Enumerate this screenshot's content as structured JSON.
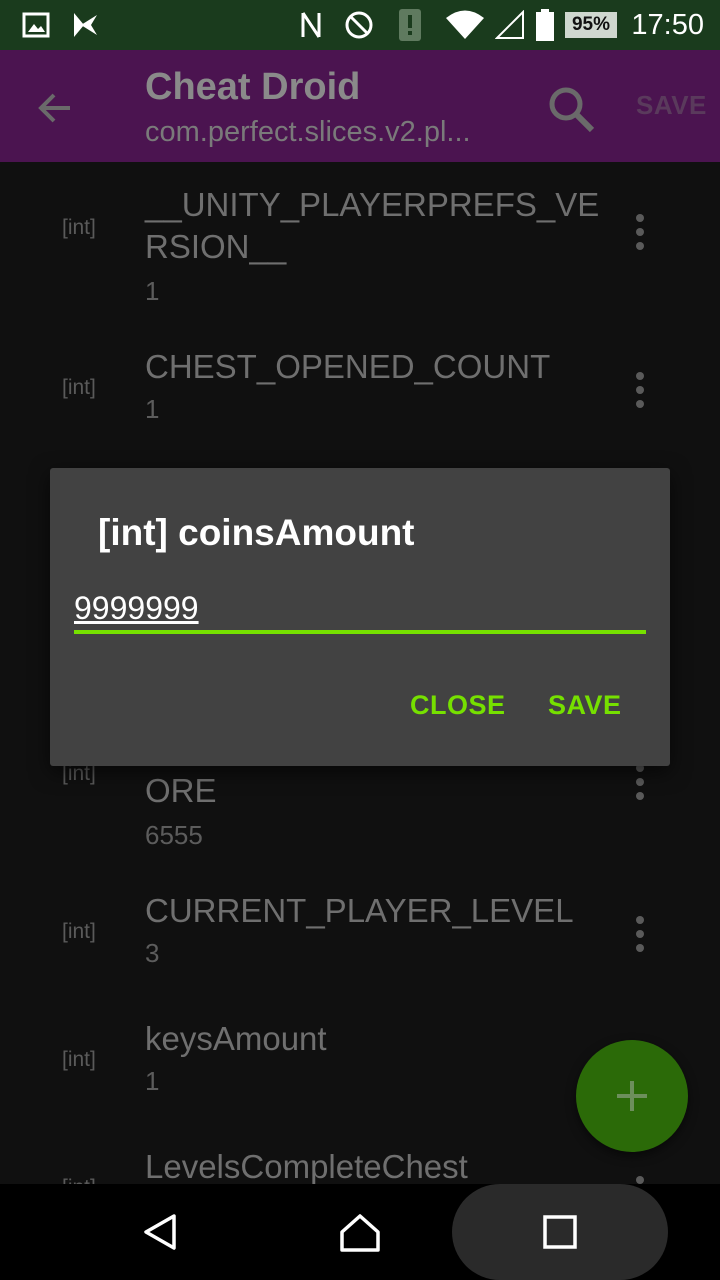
{
  "status_bar": {
    "time": "17:50",
    "battery_percent": "95%",
    "icons": [
      "image-notification-icon",
      "app-notification-icon",
      "nfc-icon",
      "do-not-disturb-icon",
      "alert-icon",
      "wifi-icon",
      "signal-icon",
      "battery-icon"
    ]
  },
  "toolbar": {
    "title": "Cheat Droid",
    "subtitle": "com.perfect.slices.v2.pl...",
    "save_label": "SAVE",
    "icons": [
      "back-arrow-icon",
      "search-icon"
    ]
  },
  "list": {
    "items": [
      {
        "type": "[int]",
        "key": "__UNITY_PLAYERPREFS_VERSION__",
        "value": "1"
      },
      {
        "type": "[int]",
        "key": "CHEST_OPENED_COUNT",
        "value": "1"
      },
      {
        "type": "[int]",
        "key": "ORE",
        "value": "6555"
      },
      {
        "type": "[int]",
        "key": "CURRENT_PLAYER_LEVEL",
        "value": "3"
      },
      {
        "type": "[int]",
        "key": "keysAmount",
        "value": "1"
      },
      {
        "type": "[int]",
        "key": "LevelsCompleteChest",
        "value": ""
      }
    ]
  },
  "dialog": {
    "title": "[int] coinsAmount",
    "input_value": "9999999",
    "close_label": "CLOSE",
    "save_label": "SAVE"
  },
  "fab": {
    "icon": "plus-icon"
  },
  "nav_bar": {
    "icons": [
      "back-icon",
      "home-icon",
      "recents-icon"
    ]
  },
  "colors": {
    "accent": "#76e000",
    "toolbar": "#4b1450",
    "dialog": "#424242",
    "status_bar": "#1a3b1d",
    "fab": "#2b6a08"
  }
}
